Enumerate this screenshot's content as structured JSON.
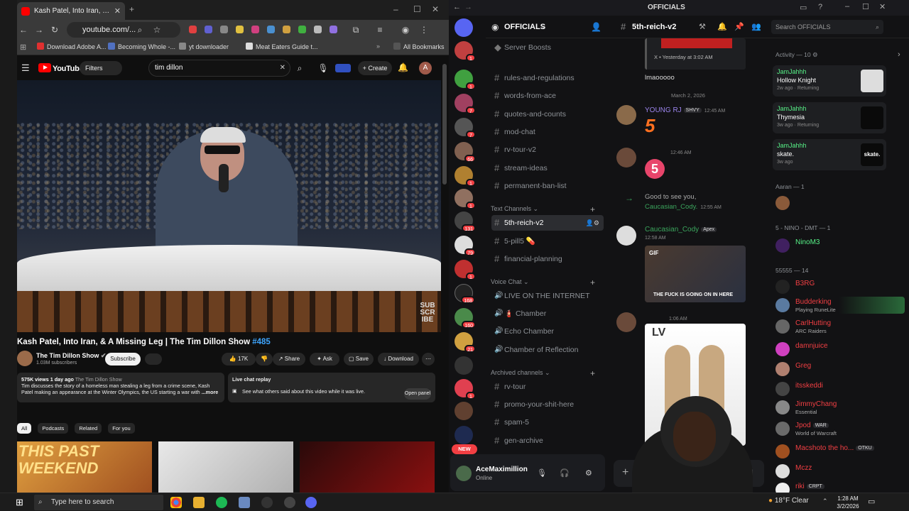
{
  "chrome": {
    "tab_title": "Kash Patel, Into Iran, & A M",
    "url": "youtube.com/...",
    "bookmarks": [
      "Download Adobe A...",
      "Becoming Whole -...",
      "yt downloader",
      "Meat Eaters Guide t..."
    ],
    "all_bookmarks": "All Bookmarks"
  },
  "youtube": {
    "logo": "YouTube",
    "filters": "Filters",
    "search_value": "tim dillon",
    "create": "Create",
    "avatar_letter": "A",
    "video_overlay": "SUB SCRIBE",
    "title_main": "Kash Patel, Into Iran, & A Missing Leg | The Tim Dillon Show",
    "title_hash": "#485",
    "channel_name": "The Tim Dillon Show",
    "subscribers": "1.03M subscribers",
    "subscribe": "Subscribe",
    "likes": "17K",
    "share": "Share",
    "ask": "Ask",
    "save": "Save",
    "download": "Download",
    "desc_views": "575K views",
    "desc_age": "1 day ago",
    "desc_channel": "The Tim Dillon Show",
    "desc_text": "Tim discusses the story of a homeless man stealing a leg from a crime scene, Kash Patel making an appearance at the Winter Olympics, the US starting a war with",
    "desc_more": "...more",
    "live_title": "Live chat replay",
    "live_text": "See what others said about this video while it was live.",
    "open_panel": "Open panel",
    "chips": [
      "All",
      "Podcasts",
      "Related",
      "For you"
    ],
    "thumb1_text": "THIS PAST WEEKEND"
  },
  "discord": {
    "window_title": "OFFICIALS",
    "server_name": "OFFICIALS",
    "server_boosts": "Server Boosts",
    "channels_top": [
      "rules-and-regulations",
      "words-from-ace",
      "quotes-and-counts",
      "mod-chat",
      "rv-tour-v2",
      "stream-ideas",
      "permanent-ban-list"
    ],
    "cat_text": "Text Channels",
    "text_channels": [
      "5th-reich-v2",
      "5-pill5",
      "financial-planning"
    ],
    "cat_voice": "Voice Chat",
    "voice_channels": [
      "LIVE ON THE INTERNET",
      "Chamber",
      "Echo Chamber",
      "Chamber of Reflection"
    ],
    "cat_archived": "Archived channels",
    "archived_channels": [
      "rv-tour",
      "promo-your-shit-here",
      "spam-5",
      "gen-archive"
    ],
    "guild_badges": [
      "1",
      "1",
      "7",
      "7",
      "66",
      "1",
      "1",
      "131",
      "79",
      "1",
      "168",
      "160",
      "21",
      "1"
    ],
    "new_badge": "NEW",
    "user_name": "AceMaximillion",
    "user_status": "Online",
    "channel_header": "5th-reich-v2",
    "search_placeholder": "Search OFFICIALS",
    "chat": {
      "embed_meta": "X • Yesterday at 3:02 AM",
      "msg_lmao": "lmaooooo",
      "date_divider": "March 2, 2026",
      "m1_user": "YOUNG RJ",
      "m1_tag": "SHVY",
      "m1_time": "12:45 AM",
      "m2_time": "12:46 AM",
      "join_text": "Good to see you,",
      "join_user": "Caucasian_Cody.",
      "join_time": "12:55 AM",
      "m3_user": "Caucasian_Cody",
      "m3_tag": "Apex",
      "m3_time": "12:58 AM",
      "gif_label": "GIF",
      "gif_caption": "THE FUCK IS GOING ON IN HERE",
      "m4_time": "1:06 AM"
    },
    "members": {
      "activity_label": "Activity — 10",
      "activities": [
        {
          "user": "JamJahhh",
          "game": "Hollow Knight",
          "since": "2w ago",
          "extra": "Returning"
        },
        {
          "user": "JamJahhh",
          "game": "Thymesia",
          "since": "3w ago",
          "extra": "Returning"
        },
        {
          "user": "JamJahhh",
          "game": "skate.",
          "since": "3w ago",
          "extra": ""
        }
      ],
      "sec_aaran": "Aaran — 1",
      "sec_nino": "5 - NINO - DMT — 1",
      "nino": "NinoM3",
      "sec_55555": "55555 — 14",
      "list": [
        {
          "name": "B3RG",
          "sub": ""
        },
        {
          "name": "Budderking",
          "sub": "Playing RuneLite"
        },
        {
          "name": "CarlHutting",
          "sub": "ARC Raiders"
        },
        {
          "name": "damnjuice",
          "sub": ""
        },
        {
          "name": "Greg",
          "sub": ""
        },
        {
          "name": "itsskeddi",
          "sub": ""
        },
        {
          "name": "JimmyChang",
          "sub": "Essential"
        },
        {
          "name": "Jpod",
          "sub": "World of Warcraft"
        },
        {
          "name": "Macshoto the ho...",
          "sub": ""
        },
        {
          "name": "Mczz",
          "sub": ""
        },
        {
          "name": "riki",
          "sub": ""
        }
      ],
      "jpod_tag": "WAR",
      "mac_tag": "OTKU",
      "riki_tag": "CRPT"
    }
  },
  "taskbar": {
    "search_placeholder": "Type here to search",
    "weather": "18°F  Clear",
    "time": "1:28 AM",
    "date": "3/2/2026"
  },
  "colors": {
    "yt_red": "#ff0000",
    "discord_green": "#57f287",
    "discord_red": "#f23f43",
    "link_blue": "#3ea6ff"
  }
}
